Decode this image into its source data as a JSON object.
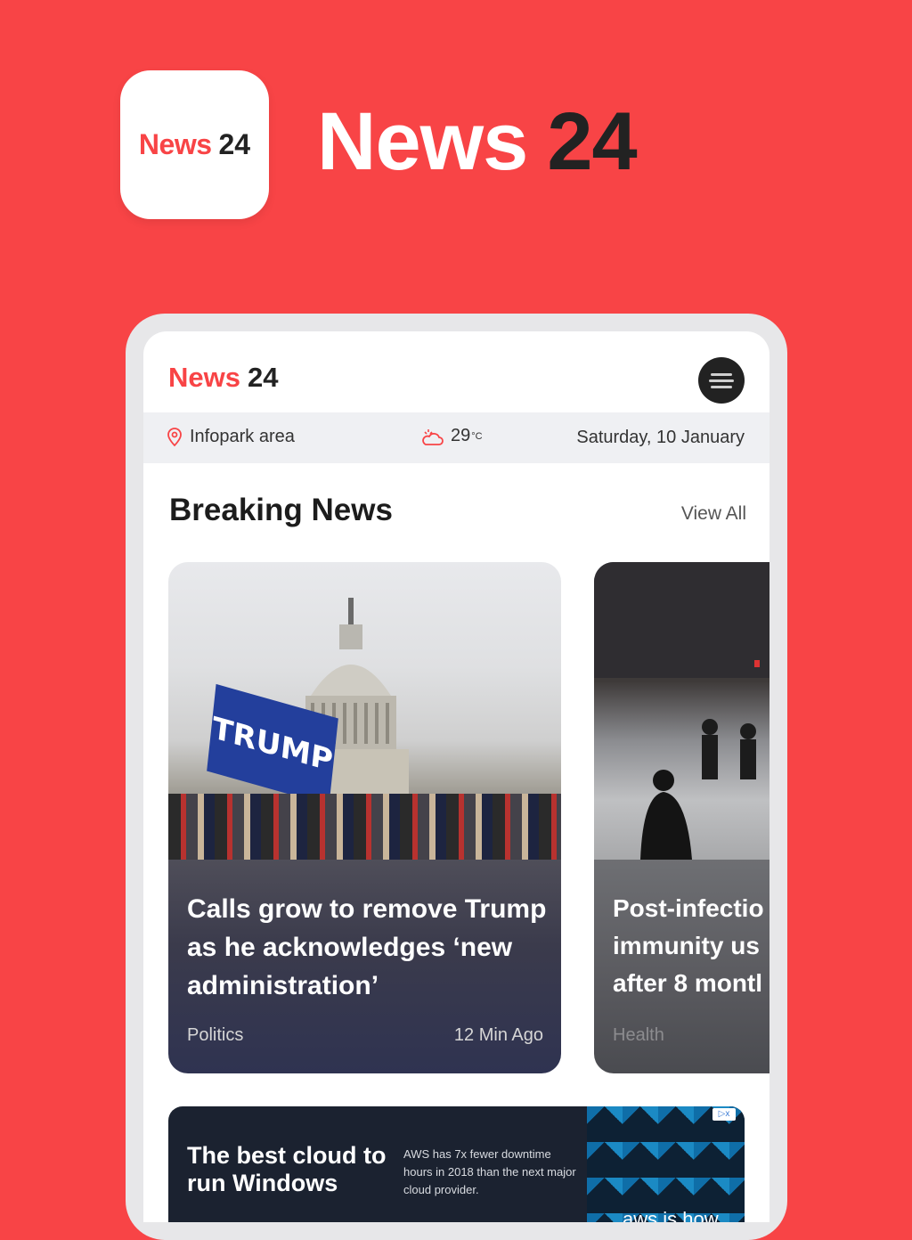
{
  "colors": {
    "accent": "#f84446",
    "dark": "#222222"
  },
  "promo": {
    "icon_brand": "News",
    "icon_number": "24",
    "title_brand": "News",
    "title_number": "24"
  },
  "app": {
    "brand": "News",
    "brand_number": "24",
    "menu_icon": "hamburger-menu-icon"
  },
  "info_bar": {
    "location": "Infopark area",
    "location_icon": "map-pin-icon",
    "temperature": "29",
    "temperature_unit": "°C",
    "weather_icon": "weather-icon",
    "date": "Saturday, 10 January"
  },
  "breaking": {
    "title": "Breaking News",
    "view_all": "View All",
    "cards": [
      {
        "headline": "Calls grow to remove Trump as he acknowledges ‘new administration’",
        "category": "Politics",
        "time": "12 Min Ago",
        "flag_text": "TRUMP"
      },
      {
        "headline_lines": [
          "Post-infectio",
          "immunity us",
          "after 8 montl"
        ],
        "category": "Health"
      }
    ]
  },
  "ad": {
    "headline": "The best cloud to run Windows",
    "body": "AWS has 7x fewer downtime hours in 2018 than the next major cloud provider.",
    "tagline": "aws is how",
    "choice_label": "▷x"
  }
}
